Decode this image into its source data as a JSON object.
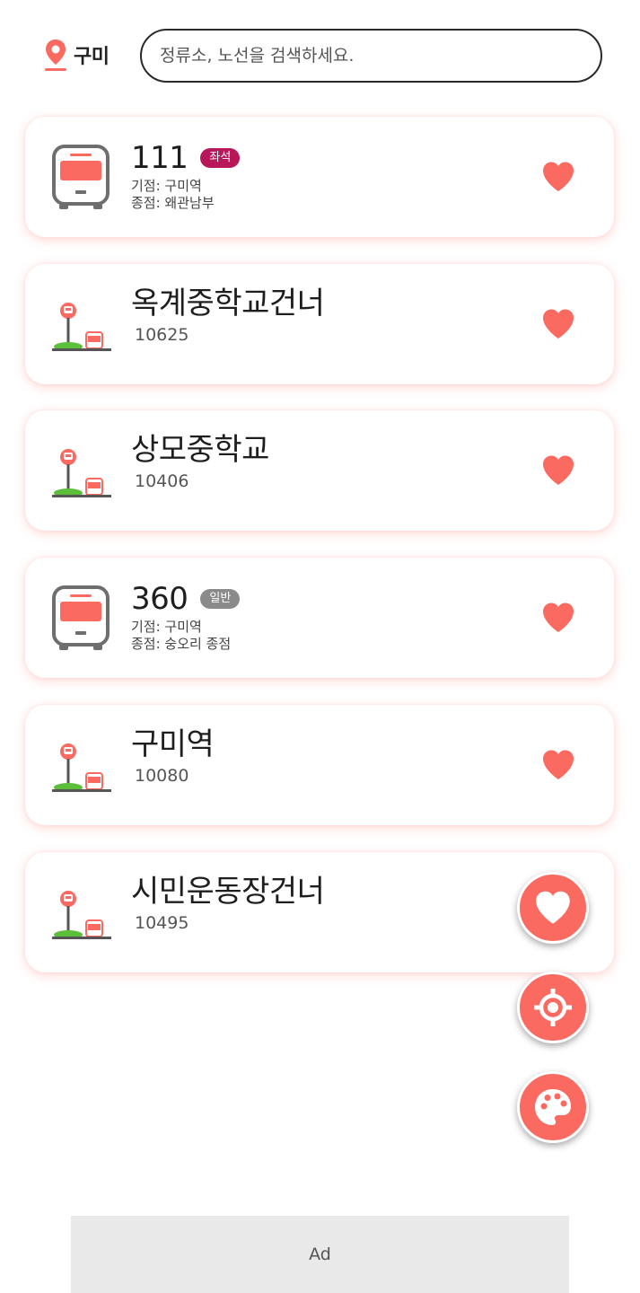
{
  "header": {
    "region_label": "구미",
    "search_placeholder": "정류소, 노선을 검색하세요."
  },
  "cards": [
    {
      "kind": "route",
      "title": "111",
      "badge": "좌석",
      "badge_color": "#b8185a",
      "start": "기점: 구미역",
      "end": "종점: 왜관남부"
    },
    {
      "kind": "stop",
      "title": "옥계중학교건너",
      "number": "10625"
    },
    {
      "kind": "stop",
      "title": "상모중학교",
      "number": "10406"
    },
    {
      "kind": "route",
      "title": "360",
      "badge": "일반",
      "badge_color": "#8a8a8a",
      "start": "기점: 구미역",
      "end": "종점: 숭오리 종점"
    },
    {
      "kind": "stop",
      "title": "구미역",
      "number": "10080"
    },
    {
      "kind": "stop",
      "title": "시민운동장건너",
      "number": "10495"
    }
  ],
  "fabs": [
    {
      "icon": "heart-icon"
    },
    {
      "icon": "location-target-icon"
    },
    {
      "icon": "palette-icon"
    }
  ],
  "ad": {
    "label": "Ad"
  },
  "colors": {
    "accent": "#fb6a60",
    "badge_seat": "#b8185a",
    "badge_normal": "#8a8a8a",
    "grass": "#5cbf3a"
  }
}
